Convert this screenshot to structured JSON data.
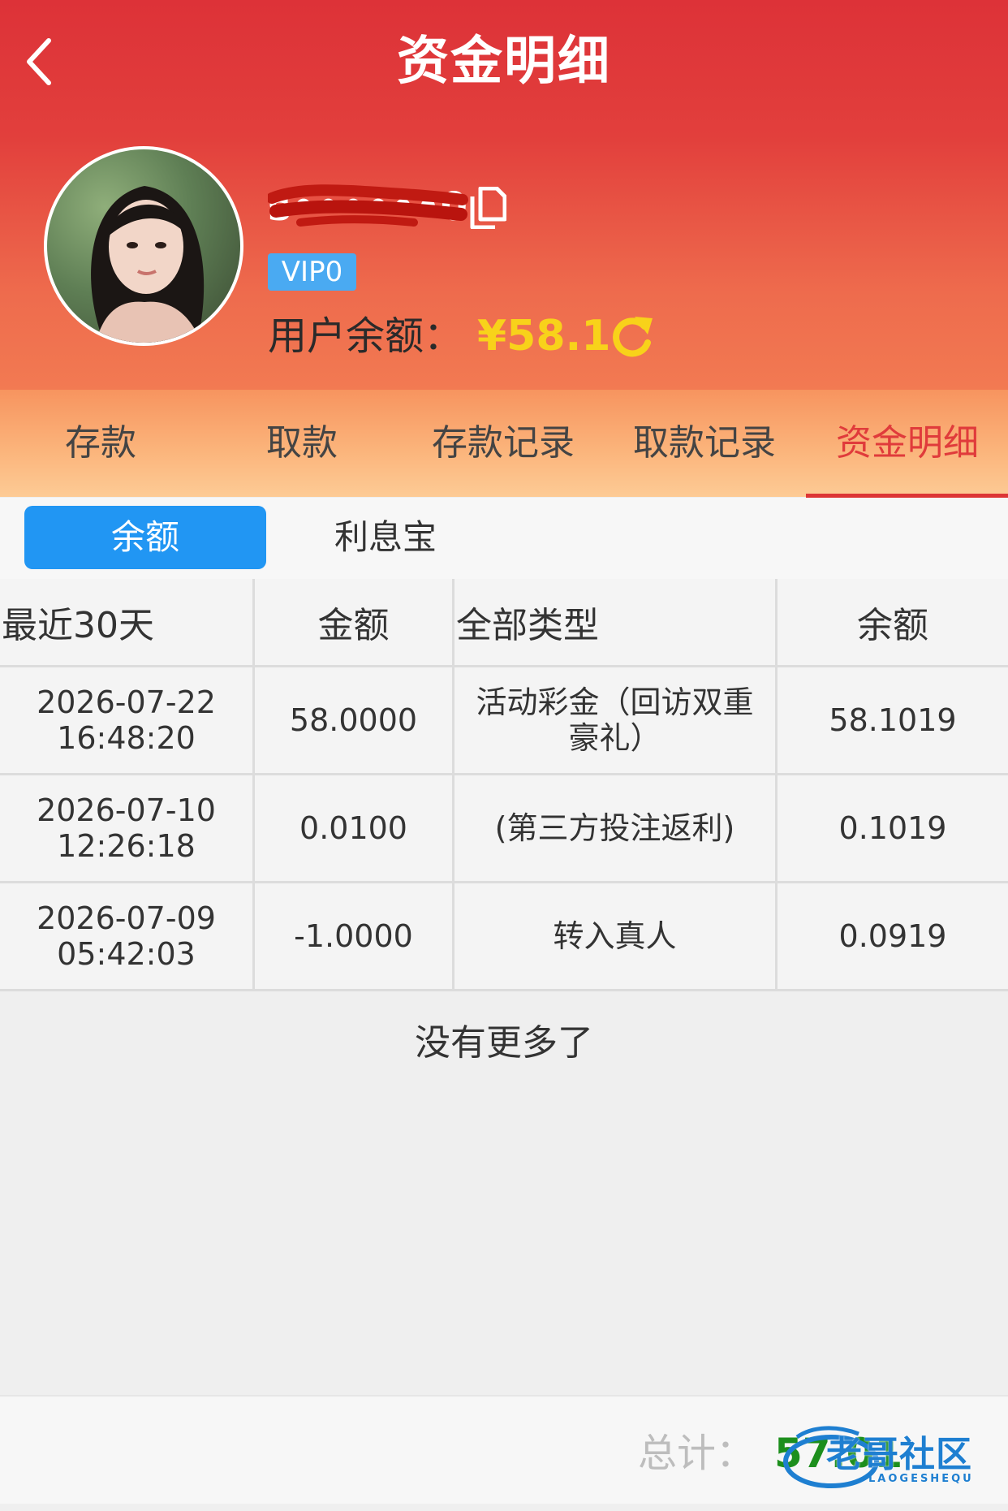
{
  "header": {
    "title": "资金明细",
    "username": "s••••••0",
    "vip": "VIP0",
    "balance_label": "用户余额：",
    "balance_value": "¥58.1"
  },
  "nav_tabs": [
    {
      "label": "存款"
    },
    {
      "label": "取款"
    },
    {
      "label": "存款记录"
    },
    {
      "label": "取款记录"
    },
    {
      "label": "资金明细",
      "active": true
    }
  ],
  "sub_tabs": [
    {
      "label": "余额",
      "active": true
    },
    {
      "label": "利息宝"
    }
  ],
  "table": {
    "headers": [
      "最近30天",
      "金额",
      "全部类型",
      "余额"
    ],
    "rows": [
      {
        "date": "2026-07-22",
        "time": "16:48:20",
        "amount": "58.0000",
        "type": "活动彩金（回访双重豪礼）",
        "balance": "58.1019"
      },
      {
        "date": "2026-07-10",
        "time": "12:26:18",
        "amount": "0.0100",
        "type": "(第三方投注返利)",
        "balance": "0.1019"
      },
      {
        "date": "2026-07-09",
        "time": "05:42:03",
        "amount": "-1.0000",
        "type": "转入真人",
        "balance": "0.0919"
      }
    ]
  },
  "no_more": "没有更多了",
  "footer": {
    "total_label": "总计：",
    "total_value": "57.01",
    "watermark_name": "老哥社区",
    "watermark_sub": "LAOGESHEQU"
  },
  "colors": {
    "header_red": "#dd3238",
    "balance_yellow": "#f8d21a",
    "active_tab_red": "#e03b3b",
    "vip_blue": "#4aaaf2",
    "subtab_blue": "#2196f3",
    "total_green": "#1d8f1d"
  }
}
